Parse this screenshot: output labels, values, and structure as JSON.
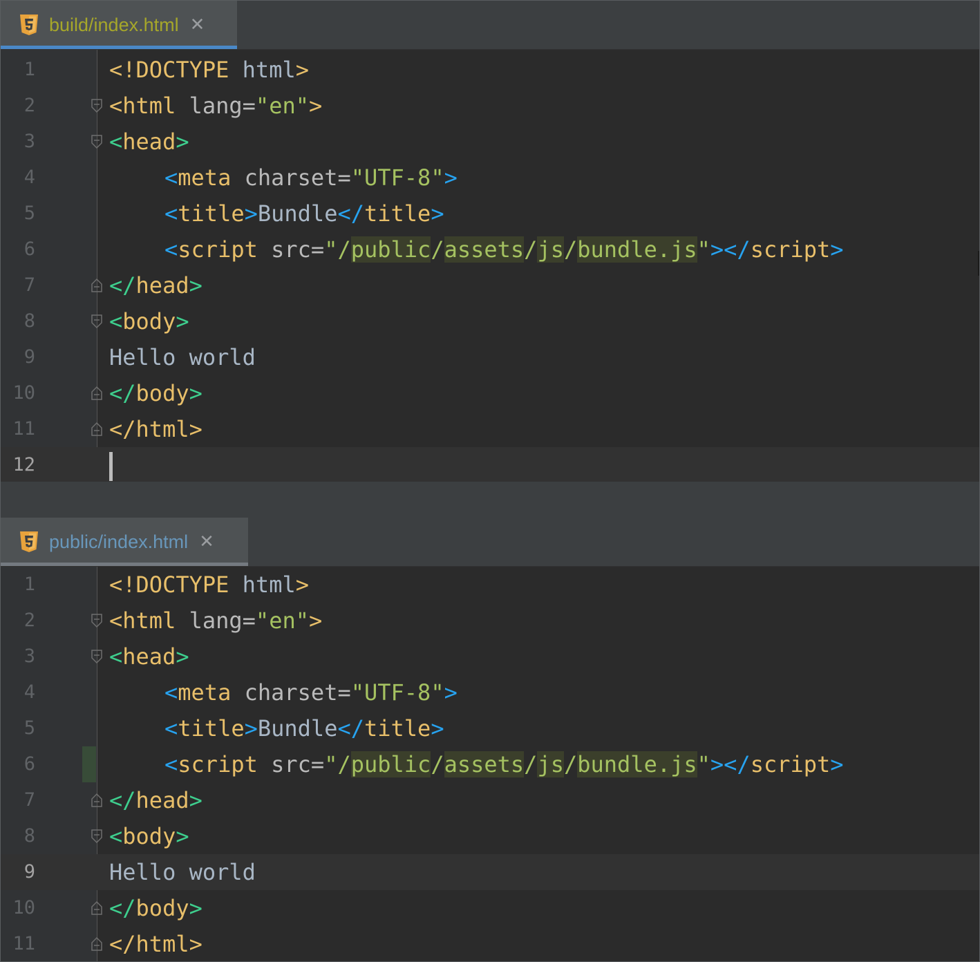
{
  "tabs": [
    {
      "label": "build/index.html"
    },
    {
      "label": "public/index.html"
    }
  ],
  "top_editor": {
    "line_numbers": [
      "1",
      "2",
      "3",
      "4",
      "5",
      "6",
      "7",
      "8",
      "9",
      "10",
      "11",
      "12"
    ],
    "current_line": "12"
  },
  "bottom_editor": {
    "line_numbers": [
      "1",
      "2",
      "3",
      "4",
      "5",
      "6",
      "7",
      "8",
      "9",
      "10",
      "11"
    ],
    "current_line": "9"
  },
  "code": {
    "doctype_open": "<!DOCTYPE",
    "doctype_rest": " html",
    "lt": "<",
    "gt": ">",
    "lt_slash": "</",
    "html": "html",
    "lang_attr": " lang",
    "eq": "=",
    "lang_val": "\"en\"",
    "head": "head",
    "meta": "meta",
    "charset_attr": " charset",
    "charset_val": "\"UTF-8\"",
    "title": "title",
    "title_text": "Bundle",
    "script": "script",
    "src_attr": " src",
    "quote": "\"",
    "slash": "/",
    "seg_public": "public",
    "seg_assets": "assets",
    "seg_js": "js",
    "seg_bundle": "bundle.js",
    "body": "body",
    "hello": "Hello world"
  },
  "colors": {
    "editor_bg": "#2b2b2b",
    "tag": "#e8bf6a",
    "attr_value": "#a5c261",
    "bracket_green": "#3ecf8e",
    "bracket_blue": "#27a3f0",
    "active_tab_label": "#a6a72a",
    "inactive_tab_label": "#6897bb"
  },
  "icons": {
    "tab_file_icon": "html5-icon",
    "tab_close": "close-icon",
    "fold_open": "fold-open-icon",
    "fold_close": "fold-close-icon"
  },
  "glyphs": {
    "close": "✕"
  }
}
